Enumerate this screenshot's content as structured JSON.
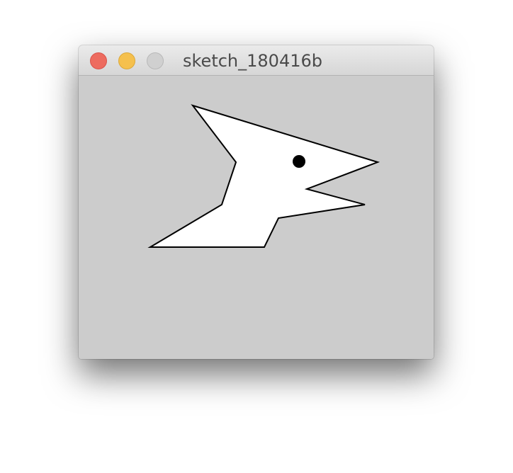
{
  "window": {
    "title": "sketch_180416b",
    "buttons": [
      {
        "name": "close",
        "color": "#ed6b5f",
        "border": "#d9534b"
      },
      {
        "name": "minimize",
        "color": "#f5c04d",
        "border": "#dba83a"
      },
      {
        "name": "zoom",
        "color": "#d0d0d0",
        "border": "#b8b8b8"
      }
    ]
  },
  "canvas": {
    "background": "#cccccc",
    "shape": {
      "fill": "#ffffff",
      "stroke": "#000000",
      "description_icon": "bird-head-shape"
    },
    "eye": {
      "fill": "#000000"
    }
  }
}
